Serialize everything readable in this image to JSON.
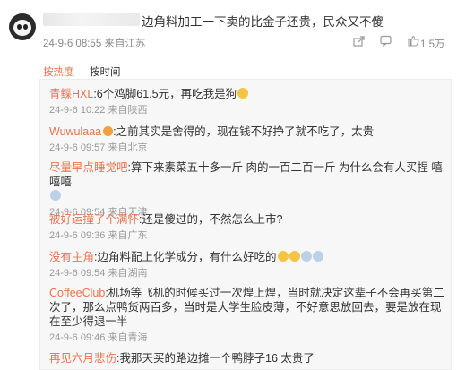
{
  "post": {
    "text": "边角料加工一下卖的比金子还贵，民众又不傻",
    "date": "24-9-6 08:55",
    "source": "来自江苏",
    "like_count": "1.5万"
  },
  "sort_tabs": {
    "hot": "按热度",
    "time": "按时间"
  },
  "replies": [
    {
      "name": "青鲽HXL",
      "text": ":6个鸡脚61.5元，再吃我是狗",
      "date": "24-9-6 10:22",
      "source": "来自陕西"
    },
    {
      "name": "Wuwulaaa",
      "text": ":之前其实是舍得的，现在钱不好挣了就不吃了，太贵",
      "date": "24-9-6 09:57",
      "source": "来自北京"
    },
    {
      "name": "尽量早点睡觉吧",
      "text": ":算下来素菜五十多一斤 肉的一百二百一斤 为什么会有人买捏 嘻嘻嘻",
      "date": "24-9-6 09:54",
      "source": "来自天津"
    },
    {
      "name": "被好运撞了个满怀",
      "text": ":还是傻过的，不然怎么上市?",
      "date": "24-9-6 09:36",
      "source": "来自广东"
    },
    {
      "name": "没有主角",
      "text": ":边角料配上化学成分，有什么好吃的",
      "date": "24-9-6 09:54",
      "source": "来自湖南"
    },
    {
      "name": "CoffeeClub",
      "text": ":机场等飞机的时候买过一次煌上煌，当时就决定这辈子不会再买第二次了，那么点鸭货两百多，当时是大学生脸皮薄，不好意思放回去，要是放在现在至少得退一半",
      "date": "24-9-6 09:46",
      "source": "来自青海"
    },
    {
      "name": "再见六月悲伤",
      "text": ":我那天买的路边摊一个鸭脖子16 太贵了",
      "date": "",
      "source": ""
    }
  ]
}
